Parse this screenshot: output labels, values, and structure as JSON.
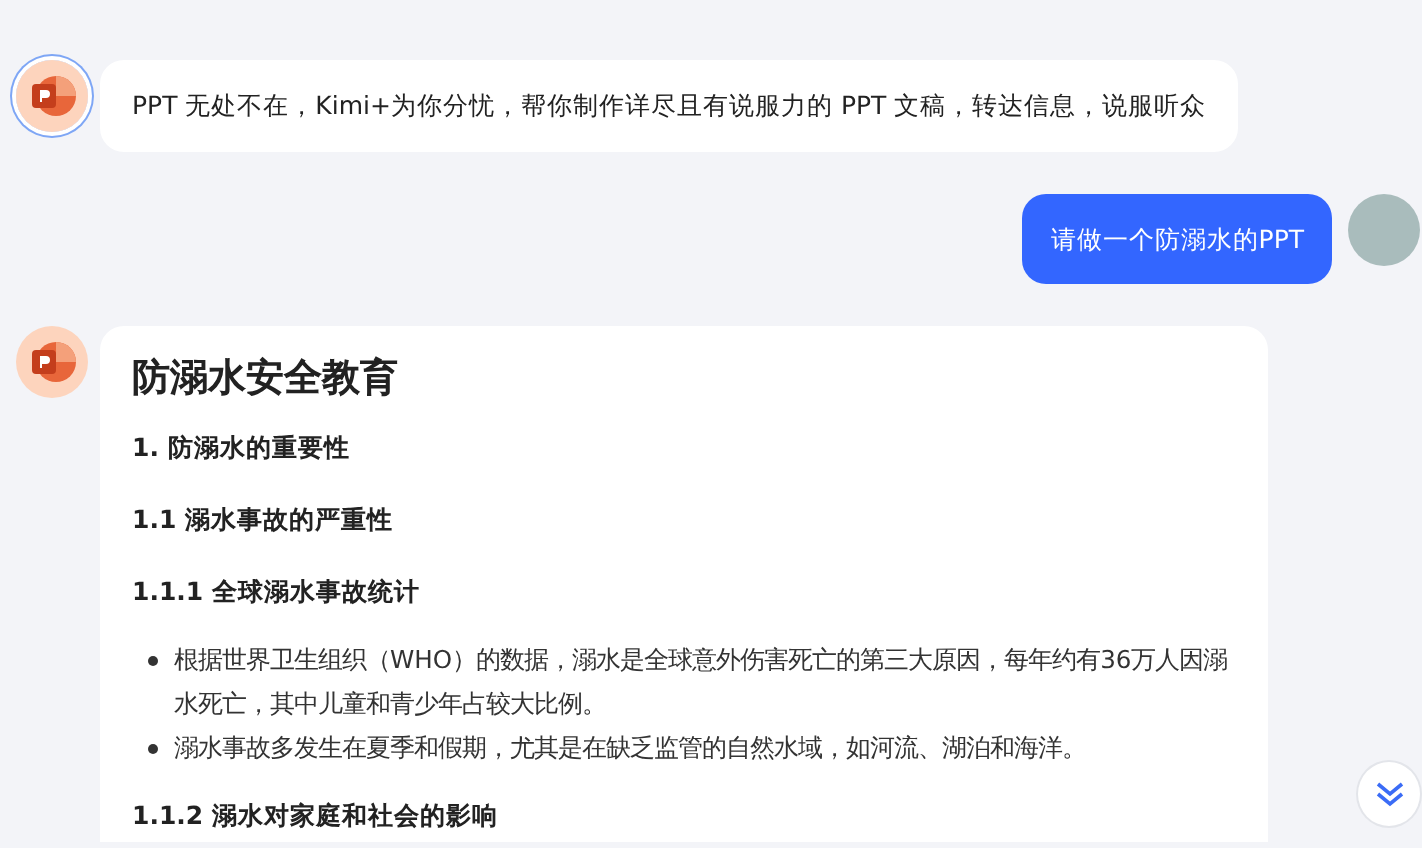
{
  "messages": [
    {
      "kind": "bot",
      "text": "PPT 无处不在，Kimi+为你分忧，帮你制作详尽且有说服力的 PPT 文稿，转达信息，说服听众"
    },
    {
      "kind": "user",
      "text": "请做一个防溺水的PPT"
    },
    {
      "kind": "doc",
      "title": "防溺水安全教育",
      "blocks": [
        {
          "kind": "heading",
          "text": "1. 防溺水的重要性"
        },
        {
          "kind": "heading",
          "text": "1.1 溺水事故的严重性"
        },
        {
          "kind": "heading",
          "text": "1.1.1 全球溺水事故统计"
        },
        {
          "kind": "list",
          "items": [
            "根据世界卫生组织（WHO）的数据，溺水是全球意外伤害死亡的第三大原因，每年约有36万人因溺水死亡，其中儿童和青少年占较大比例。",
            "溺水事故多发生在夏季和假期，尤其是在缺乏监管的自然水域，如河流、湖泊和海洋。"
          ]
        },
        {
          "kind": "heading",
          "text": "1.1.2 溺水对家庭和社会的影响"
        }
      ]
    }
  ]
}
